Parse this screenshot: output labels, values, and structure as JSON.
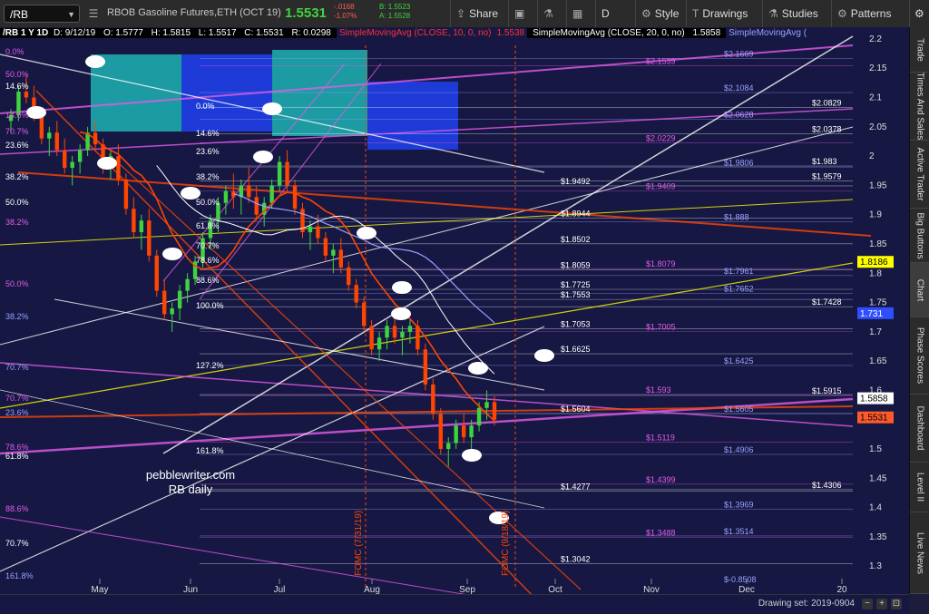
{
  "toolbar": {
    "symbol": "/RB",
    "product": "RBOB Gasoline Futures,ETH (OCT 19)",
    "last": "1.5531",
    "change": "-.0168",
    "change_pct": "-1.07%",
    "bid": "B: 1.5523",
    "ask": "A: 1.5528",
    "share": "Share",
    "d": "D",
    "style": "Style",
    "drawings": "Drawings",
    "studies": "Studies",
    "patterns": "Patterns"
  },
  "study_bar": {
    "info": "/RB 1 Y 1D",
    "date": "D: 9/12/19",
    "open": "O: 1.5777",
    "high": "H: 1.5815",
    "low": "L: 1.5517",
    "close": "C: 1.5531",
    "range": "R: 0.0298",
    "sma10": "SimpleMovingAvg (CLOSE, 10, 0, no)",
    "sma10_val": "1.5538",
    "sma20": "SimpleMovingAvg (CLOSE, 20, 0, no)",
    "sma20_val": "1.5858",
    "sma_next": "SimpleMovingAvg ("
  },
  "right_tabs": [
    "Trade",
    "Times And Sales",
    "Active Trader",
    "Big Buttons",
    "Chart",
    "Phase Scores",
    "Dashboard",
    "Level II",
    "Live News"
  ],
  "bottom": {
    "drawing_set": "Drawing set: 2019-0904"
  },
  "colors": {
    "bg": "#161843",
    "magenta": "#e35ce8",
    "green": "#3fd43f",
    "red": "#ff5a5a",
    "orange": "#ff4500",
    "yellow": "#ffff00"
  },
  "chart_data": {
    "type": "candlestick",
    "x_labels": [
      "May",
      "Jun",
      "Jul",
      "Aug",
      "Sep",
      "Oct",
      "Nov",
      "Dec",
      "20"
    ],
    "price_axis": [
      "2.2",
      "2.15",
      "2.1",
      "2.05",
      "2",
      "1.95",
      "1.9",
      "1.85",
      "1.8",
      "1.75",
      "1.7",
      "1.65",
      "1.6",
      "1.55",
      "1.5",
      "1.45",
      "1.4",
      "1.35",
      "1.3"
    ],
    "ylim": [
      1.26,
      2.22
    ],
    "price_badges": [
      {
        "value": "1.8186",
        "color": "#ffff00",
        "text": "#000"
      },
      {
        "value": "1.731",
        "color": "#2f4fff",
        "text": "#fff"
      },
      {
        "value": "1.5858",
        "color": "#ffffff",
        "text": "#000"
      },
      {
        "value": "1.5531",
        "color": "#ff5a2a",
        "text": "#000"
      }
    ],
    "level_labels": [
      {
        "v": "$2.1669",
        "c": "#9aa0ff"
      },
      {
        "v": "$2.1539",
        "c": "#e35ce8"
      },
      {
        "v": "$2.1084",
        "c": "#9aa0ff"
      },
      {
        "v": "$2.0829",
        "c": "#fff"
      },
      {
        "v": "$2.0628",
        "c": "#9aa0ff"
      },
      {
        "v": "$2.0378",
        "c": "#fff"
      },
      {
        "v": "$2.0229",
        "c": "#e35ce8"
      },
      {
        "v": "$1.983",
        "c": "#fff"
      },
      {
        "v": "$1.9806",
        "c": "#9aa0ff"
      },
      {
        "v": "$1.9579",
        "c": "#fff"
      },
      {
        "v": "$1.9492",
        "c": "#fff"
      },
      {
        "v": "$1.9409",
        "c": "#e35ce8"
      },
      {
        "v": "$1.8944",
        "c": "#fff"
      },
      {
        "v": "$1.888",
        "c": "#9aa0ff"
      },
      {
        "v": "$1.8502",
        "c": "#fff"
      },
      {
        "v": "$1.8079",
        "c": "#e35ce8"
      },
      {
        "v": "$1.8059",
        "c": "#fff"
      },
      {
        "v": "$1.7961",
        "c": "#9aa0ff"
      },
      {
        "v": "$1.7725",
        "c": "#fff"
      },
      {
        "v": "$1.7652",
        "c": "#9aa0ff"
      },
      {
        "v": "$1.7553",
        "c": "#fff"
      },
      {
        "v": "$1.7428",
        "c": "#fff"
      },
      {
        "v": "$1.7053",
        "c": "#fff"
      },
      {
        "v": "$1.7005",
        "c": "#e35ce8"
      },
      {
        "v": "$1.6625",
        "c": "#fff"
      },
      {
        "v": "$1.6425",
        "c": "#9aa0ff"
      },
      {
        "v": "$1.593",
        "c": "#e35ce8"
      },
      {
        "v": "$1.5915",
        "c": "#fff"
      },
      {
        "v": "$1.5604",
        "c": "#fff"
      },
      {
        "v": "$1.5605",
        "c": "#9aa0ff"
      },
      {
        "v": "$1.5119",
        "c": "#e35ce8"
      },
      {
        "v": "$1.4906",
        "c": "#9aa0ff"
      },
      {
        "v": "$1.4399",
        "c": "#e35ce8"
      },
      {
        "v": "$1.4306",
        "c": "#fff"
      },
      {
        "v": "$1.4277",
        "c": "#fff"
      },
      {
        "v": "$1.3969",
        "c": "#9aa0ff"
      },
      {
        "v": "$1.3514",
        "c": "#9aa0ff"
      },
      {
        "v": "$1.3488",
        "c": "#e35ce8"
      },
      {
        "v": "$1.3042",
        "c": "#fff"
      },
      {
        "v": "$-0.8508",
        "c": "#9aa0ff"
      }
    ],
    "fib_labels": [
      {
        "t": "0.0%",
        "c": "#e35ce8"
      },
      {
        "t": "50.0%",
        "c": "#e35ce8"
      },
      {
        "t": "14.6%",
        "c": "#fff"
      },
      {
        "t": "14.6%",
        "c": "#e35ce8"
      },
      {
        "t": "70.7%",
        "c": "#e35ce8"
      },
      {
        "t": "23.6%",
        "c": "#fff"
      },
      {
        "t": "38.2%",
        "c": "#e35ce8"
      },
      {
        "t": "38.2%",
        "c": "#fff"
      },
      {
        "t": "50.0%",
        "c": "#e35ce8"
      },
      {
        "t": "38.2%",
        "c": "#9aa0ff"
      },
      {
        "t": "50.0%",
        "c": "#fff"
      },
      {
        "t": "70.7%",
        "c": "#9aa0ff"
      },
      {
        "t": "70.7%",
        "c": "#e35ce8"
      },
      {
        "t": "23.6%",
        "c": "#9aa0ff"
      },
      {
        "t": "78.6%",
        "c": "#e35ce8"
      },
      {
        "t": "61.8%",
        "c": "#fff"
      },
      {
        "t": "88.6%",
        "c": "#e35ce8"
      },
      {
        "t": "70.7%",
        "c": "#fff"
      },
      {
        "t": "161.8%",
        "c": "#9aa0ff"
      },
      {
        "t": "0.0%",
        "c": "#fff"
      },
      {
        "t": "14.6%",
        "c": "#fff"
      },
      {
        "t": "23.6%",
        "c": "#fff"
      },
      {
        "t": "38.2%",
        "c": "#fff"
      },
      {
        "t": "50.0%",
        "c": "#fff"
      },
      {
        "t": "61.8%",
        "c": "#fff"
      },
      {
        "t": "70.7%",
        "c": "#fff"
      },
      {
        "t": "78.6%",
        "c": "#fff"
      },
      {
        "t": "88.6%",
        "c": "#fff"
      },
      {
        "t": "100.0%",
        "c": "#fff"
      },
      {
        "t": "127.2%",
        "c": "#fff"
      },
      {
        "t": "161.8%",
        "c": "#fff"
      }
    ],
    "watermark": [
      "pebblewriter.com",
      "RB daily"
    ],
    "event_labels": [
      "FOMC (7/31/19)",
      "FOMC (9/18/19)"
    ],
    "candles": [
      [
        2.06,
        2.08,
        2.04,
        2.07
      ],
      [
        2.07,
        2.12,
        2.06,
        2.11
      ],
      [
        2.11,
        2.14,
        2.09,
        2.1
      ],
      [
        2.1,
        2.12,
        2.06,
        2.07
      ],
      [
        2.07,
        2.08,
        2.02,
        2.03
      ],
      [
        2.03,
        2.05,
        2.0,
        2.04
      ],
      [
        2.04,
        2.06,
        2.0,
        2.01
      ],
      [
        2.01,
        2.03,
        1.97,
        1.98
      ],
      [
        1.98,
        2.0,
        1.95,
        1.99
      ],
      [
        1.99,
        2.02,
        1.97,
        2.01
      ],
      [
        2.01,
        2.05,
        2.0,
        2.04
      ],
      [
        2.04,
        2.06,
        2.01,
        2.02
      ],
      [
        2.02,
        2.03,
        1.97,
        1.98
      ],
      [
        1.98,
        2.01,
        1.96,
        2.0
      ],
      [
        2.0,
        2.02,
        1.95,
        1.96
      ],
      [
        1.96,
        1.97,
        1.9,
        1.91
      ],
      [
        1.91,
        1.93,
        1.86,
        1.87
      ],
      [
        1.87,
        1.9,
        1.84,
        1.89
      ],
      [
        1.89,
        1.91,
        1.82,
        1.83
      ],
      [
        1.83,
        1.84,
        1.76,
        1.77
      ],
      [
        1.77,
        1.79,
        1.72,
        1.73
      ],
      [
        1.73,
        1.75,
        1.7,
        1.74
      ],
      [
        1.74,
        1.78,
        1.72,
        1.77
      ],
      [
        1.77,
        1.8,
        1.75,
        1.79
      ],
      [
        1.79,
        1.83,
        1.78,
        1.82
      ],
      [
        1.82,
        1.87,
        1.81,
        1.86
      ],
      [
        1.86,
        1.9,
        1.84,
        1.89
      ],
      [
        1.89,
        1.93,
        1.87,
        1.92
      ],
      [
        1.92,
        1.95,
        1.9,
        1.94
      ],
      [
        1.94,
        1.97,
        1.91,
        1.93
      ],
      [
        1.93,
        1.96,
        1.9,
        1.95
      ],
      [
        1.95,
        1.98,
        1.92,
        1.93
      ],
      [
        1.93,
        1.95,
        1.89,
        1.9
      ],
      [
        1.9,
        1.93,
        1.88,
        1.92
      ],
      [
        1.92,
        1.96,
        1.91,
        1.95
      ],
      [
        1.95,
        2.0,
        1.94,
        1.99
      ],
      [
        1.99,
        2.01,
        1.94,
        1.95
      ],
      [
        1.95,
        1.96,
        1.9,
        1.91
      ],
      [
        1.91,
        1.92,
        1.86,
        1.87
      ],
      [
        1.87,
        1.89,
        1.84,
        1.88
      ],
      [
        1.88,
        1.9,
        1.85,
        1.86
      ],
      [
        1.86,
        1.87,
        1.82,
        1.83
      ],
      [
        1.83,
        1.85,
        1.8,
        1.84
      ],
      [
        1.84,
        1.86,
        1.8,
        1.81
      ],
      [
        1.81,
        1.82,
        1.77,
        1.78
      ],
      [
        1.78,
        1.79,
        1.74,
        1.75
      ],
      [
        1.75,
        1.76,
        1.7,
        1.71
      ],
      [
        1.71,
        1.72,
        1.66,
        1.67
      ],
      [
        1.67,
        1.7,
        1.65,
        1.69
      ],
      [
        1.69,
        1.72,
        1.67,
        1.71
      ],
      [
        1.71,
        1.73,
        1.68,
        1.69
      ],
      [
        1.69,
        1.71,
        1.66,
        1.7
      ],
      [
        1.7,
        1.72,
        1.68,
        1.71
      ],
      [
        1.71,
        1.72,
        1.66,
        1.67
      ],
      [
        1.67,
        1.68,
        1.6,
        1.61
      ],
      [
        1.61,
        1.62,
        1.55,
        1.56
      ],
      [
        1.56,
        1.57,
        1.49,
        1.5
      ],
      [
        1.5,
        1.52,
        1.47,
        1.51
      ],
      [
        1.51,
        1.55,
        1.5,
        1.54
      ],
      [
        1.54,
        1.56,
        1.51,
        1.52
      ],
      [
        1.52,
        1.55,
        1.5,
        1.54
      ],
      [
        1.54,
        1.58,
        1.53,
        1.57
      ],
      [
        1.57,
        1.6,
        1.55,
        1.58
      ],
      [
        1.58,
        1.59,
        1.54,
        1.55
      ]
    ]
  }
}
